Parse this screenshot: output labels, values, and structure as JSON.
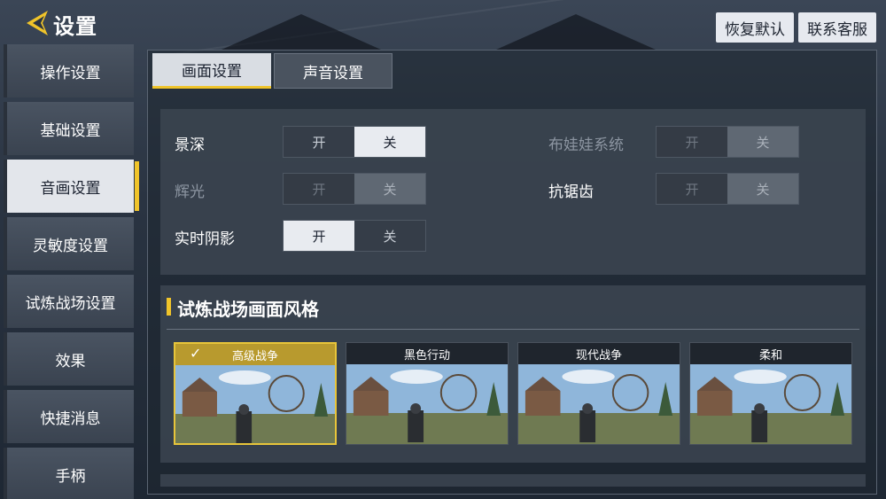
{
  "header": {
    "title": "设置",
    "reset_label": "恢复默认",
    "support_label": "联系客服"
  },
  "sidebar": {
    "items": [
      {
        "label": "操作设置"
      },
      {
        "label": "基础设置"
      },
      {
        "label": "音画设置"
      },
      {
        "label": "灵敏度设置"
      },
      {
        "label": "试炼战场设置"
      },
      {
        "label": "效果"
      },
      {
        "label": "快捷消息"
      },
      {
        "label": "手柄"
      }
    ],
    "active_index": 2
  },
  "tabs": [
    {
      "label": "画面设置",
      "active": true
    },
    {
      "label": "声音设置",
      "active": false
    }
  ],
  "settings": {
    "on_label": "开",
    "off_label": "关",
    "depth_of_field": {
      "label": "景深",
      "value": "关",
      "enabled": true
    },
    "bloom": {
      "label": "辉光",
      "value": "关",
      "enabled": false
    },
    "realtime_shadow": {
      "label": "实时阴影",
      "value": "开",
      "enabled": true
    },
    "ragdoll": {
      "label": "布娃娃系统",
      "value": "关",
      "enabled": false
    },
    "antialiasing": {
      "label": "抗锯齿",
      "value": "关",
      "enabled": true
    }
  },
  "style_section": {
    "title": "试炼战场画面风格",
    "options": [
      {
        "label": "高级战争",
        "selected": true
      },
      {
        "label": "黑色行动",
        "selected": false
      },
      {
        "label": "现代战争",
        "selected": false
      },
      {
        "label": "柔和",
        "selected": false
      }
    ]
  },
  "colors": {
    "accent": "#f0c42a",
    "selected_border": "#e8c53a"
  }
}
